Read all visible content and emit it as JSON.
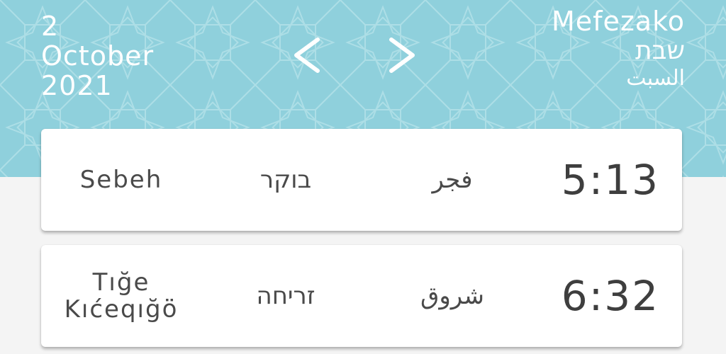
{
  "colors": {
    "header_background": "#8fd0dc",
    "header_text": "#ffffff",
    "card_background": "#ffffff",
    "page_background": "#f4f4f4",
    "card_text": "#4a4a4a"
  },
  "header": {
    "date": {
      "day": "2",
      "month": "October",
      "year": "2021"
    },
    "prev_icon": "chevron-left-icon",
    "next_icon": "chevron-right-icon",
    "weekday": {
      "local": "Mefezako",
      "hebrew": "שבת",
      "arabic": "السبت"
    }
  },
  "prayer_times": [
    {
      "local": "Sebeh",
      "hebrew": "בוקר",
      "arabic": "فجر",
      "time": "5:13"
    },
    {
      "local": "Tığe Kıćeqığö",
      "hebrew": "זריחה",
      "arabic": "شروق",
      "time": "6:32"
    }
  ]
}
